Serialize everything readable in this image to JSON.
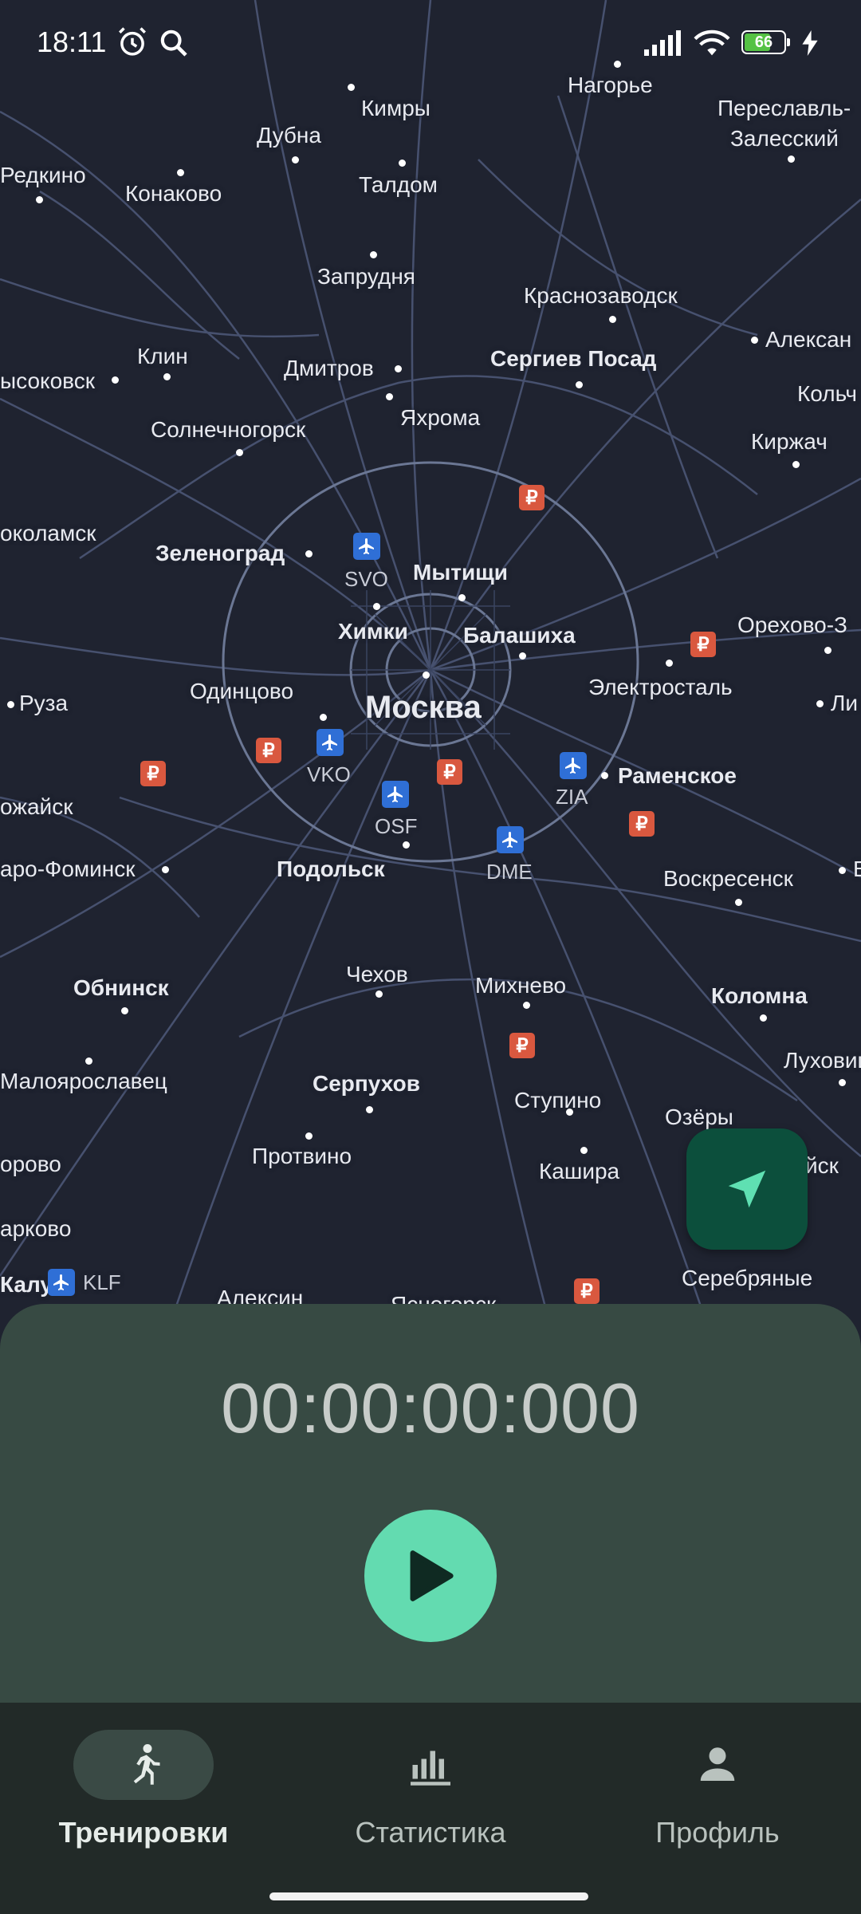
{
  "status_bar": {
    "time": "18:11",
    "battery_percent": "66",
    "icons": [
      "alarm-icon",
      "search-icon",
      "signal-icon",
      "wifi-icon",
      "battery-icon",
      "charging-icon"
    ]
  },
  "map": {
    "labels": {
      "kimry": "Кимры",
      "nagorye": "Нагорье",
      "pereslavl1": "Переславль-",
      "pereslavl2": "Залесский",
      "dubna": "Дубна",
      "redkino": "Редкино",
      "konakovo": "Конаково",
      "taldom": "Талдом",
      "zaprudnya": "Запрудня",
      "krasnozavodsk": "Краснозаводск",
      "klin": "Клин",
      "dmitrov": "Дмитров",
      "sergiev": "Сергиев Посад",
      "alexan": "Алексан",
      "vysokovsk": "ысоковск",
      "kolch": "Кольч",
      "solnech": "Солнечногорск",
      "yakhroma": "Яхрома",
      "kirzhach": "Киржач",
      "volokolamsk": "околамск",
      "zelenograd": "Зеленоград",
      "svo": "SVO",
      "mytishchi": "Мытищи",
      "khimki": "Химки",
      "balashikha": "Балашиха",
      "orekhovo": "Орехово-З",
      "odintsovo": "Одинцово",
      "moskva": "Москва",
      "elektrostal": "Электросталь",
      "ruza": "Руза",
      "li": "Ли",
      "vko": "VKO",
      "ramenskoe": "Раменское",
      "mozhaysk": "ожайск",
      "zia": "ZIA",
      "osf": "OSF",
      "naro": "аро-Фоминск",
      "podolsk": "Подольск",
      "dme": "DME",
      "voskresensk": "Воскресенск",
      "v": "В",
      "chekhov": "Чехов",
      "mikhnevo": "Михнево",
      "obninsk": "Обнинск",
      "kolomna": "Коломна",
      "lukhovi": "Луховиц",
      "maloyar": "Малоярославец",
      "serpukhov": "Серпухов",
      "stupino": "Ступино",
      "ozery": "Озёры",
      "borovo": "орово",
      "protvino": "Протвино",
      "kashira": "Кашира",
      "ysk": "йск",
      "zharkovo": "арково",
      "kaluga": "Калуга",
      "klf": "KLF",
      "serebryanye": "Серебряные",
      "aleksin": "Алексин",
      "yasnogorsk": "Ясногорск"
    }
  },
  "timer": {
    "value": "00:00:00:000"
  },
  "nav": {
    "items": [
      {
        "label": "Тренировки",
        "icon": "running-icon",
        "active": true
      },
      {
        "label": "Статистика",
        "icon": "bar-chart-icon",
        "active": false
      },
      {
        "label": "Профиль",
        "icon": "person-icon",
        "active": false
      }
    ]
  },
  "colors": {
    "map_bg": "#1f2330",
    "panel_bg": "#374a43",
    "accent": "#63dbb0",
    "fab_bg": "#0c4f3c",
    "nav_bg": "#222a28"
  }
}
